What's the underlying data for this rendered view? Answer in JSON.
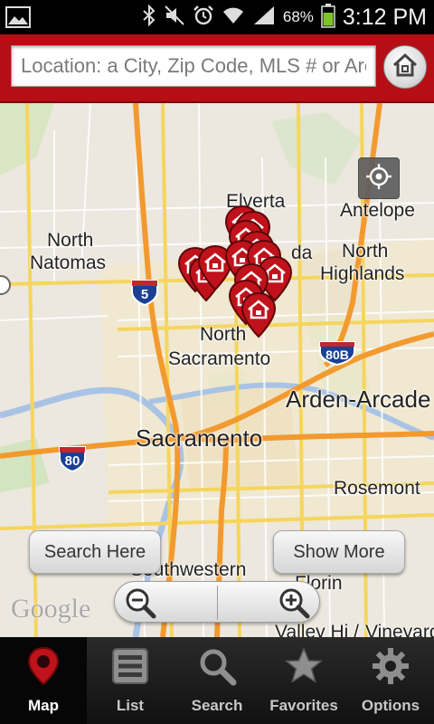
{
  "status_bar": {
    "battery_pct": "68%",
    "time": "3:12 PM"
  },
  "header": {
    "search_placeholder": "Location: a City, Zip Code, MLS # or Area",
    "search_value": ""
  },
  "map": {
    "places": {
      "elverta": "Elverta",
      "antelope": "Antelope",
      "north_natomas_1": "North",
      "north_natomas_2": "Natomas",
      "north_highlands_1": "North",
      "north_highlands_2": "Highlands",
      "north_sacramento_1": "North",
      "north_sacramento_2": "Sacramento",
      "arden_arcade": "Arden-Arcade",
      "sacramento": "Sacramento",
      "rosemont": "Rosemont",
      "southwestern": "Southwestern",
      "florin": "Florin",
      "valley_hi": "Valley Hi /",
      "vineyard": "Vineyard",
      "partial_da": "da"
    },
    "shields": {
      "i5": "5",
      "i80b": "80B",
      "i80": "80"
    },
    "attribution": "Google",
    "search_here_label": "Search Here",
    "show_more_label": "Show More",
    "pin_count": 13
  },
  "nav": {
    "items": [
      {
        "label": "Map",
        "icon": "map-pin-icon",
        "active": true
      },
      {
        "label": "List",
        "icon": "list-icon",
        "active": false
      },
      {
        "label": "Search",
        "icon": "magnifier-icon",
        "active": false
      },
      {
        "label": "Favorites",
        "icon": "star-icon",
        "active": false
      },
      {
        "label": "Options",
        "icon": "gear-icon",
        "active": false
      }
    ]
  },
  "colors": {
    "brand_red": "#b50e15",
    "pin_red": "#c0121b",
    "nav_bg": "#1c1c1c"
  }
}
